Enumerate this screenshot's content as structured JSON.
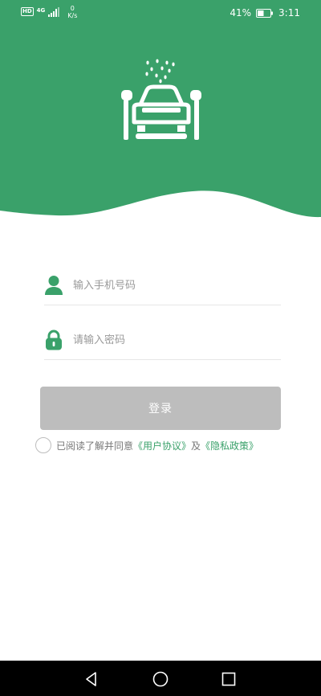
{
  "colors": {
    "brand_green": "#3aa16a",
    "button_disabled": "#bdbdbd",
    "hint_text": "#9a9a9a",
    "nav_bar": "#000000"
  },
  "status_bar": {
    "hd_badge": "HD",
    "net_type": "4G",
    "net_speed_value": "0",
    "net_speed_unit": "K/s",
    "battery_percent": "41%",
    "time": "3:11"
  },
  "header": {
    "logo_icon": "car-wash-icon"
  },
  "form": {
    "phone": {
      "placeholder": "输入手机号码",
      "value": "",
      "icon": "user-icon"
    },
    "password": {
      "placeholder": "请输入密码",
      "value": "",
      "icon": "lock-icon"
    },
    "login_label": "登录",
    "login_enabled": false
  },
  "agreement": {
    "checked": false,
    "prefix": "已阅读了解并同意",
    "user_agreement": "《用户协议》",
    "joiner": "及",
    "privacy_policy": "《隐私政策》"
  },
  "nav_bar": {
    "buttons": [
      "back-icon",
      "home-icon",
      "recents-icon"
    ]
  }
}
